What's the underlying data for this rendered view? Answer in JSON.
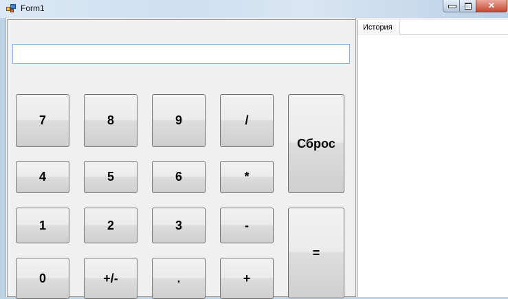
{
  "window": {
    "title": "Form1",
    "minimize_glyph": "",
    "maximize_glyph": "",
    "close_glyph": "✕"
  },
  "display": {
    "value": "",
    "placeholder": ""
  },
  "buttons": {
    "b7": "7",
    "b8": "8",
    "b9": "9",
    "div": "/",
    "b4": "4",
    "b5": "5",
    "b6": "6",
    "mul": "*",
    "b1": "1",
    "b2": "2",
    "b3": "3",
    "sub": "-",
    "b0": "0",
    "neg": "+/-",
    "dot": ".",
    "add": "+",
    "reset": "Сброс",
    "equals": "="
  },
  "history": {
    "column_header": "История",
    "items": []
  }
}
